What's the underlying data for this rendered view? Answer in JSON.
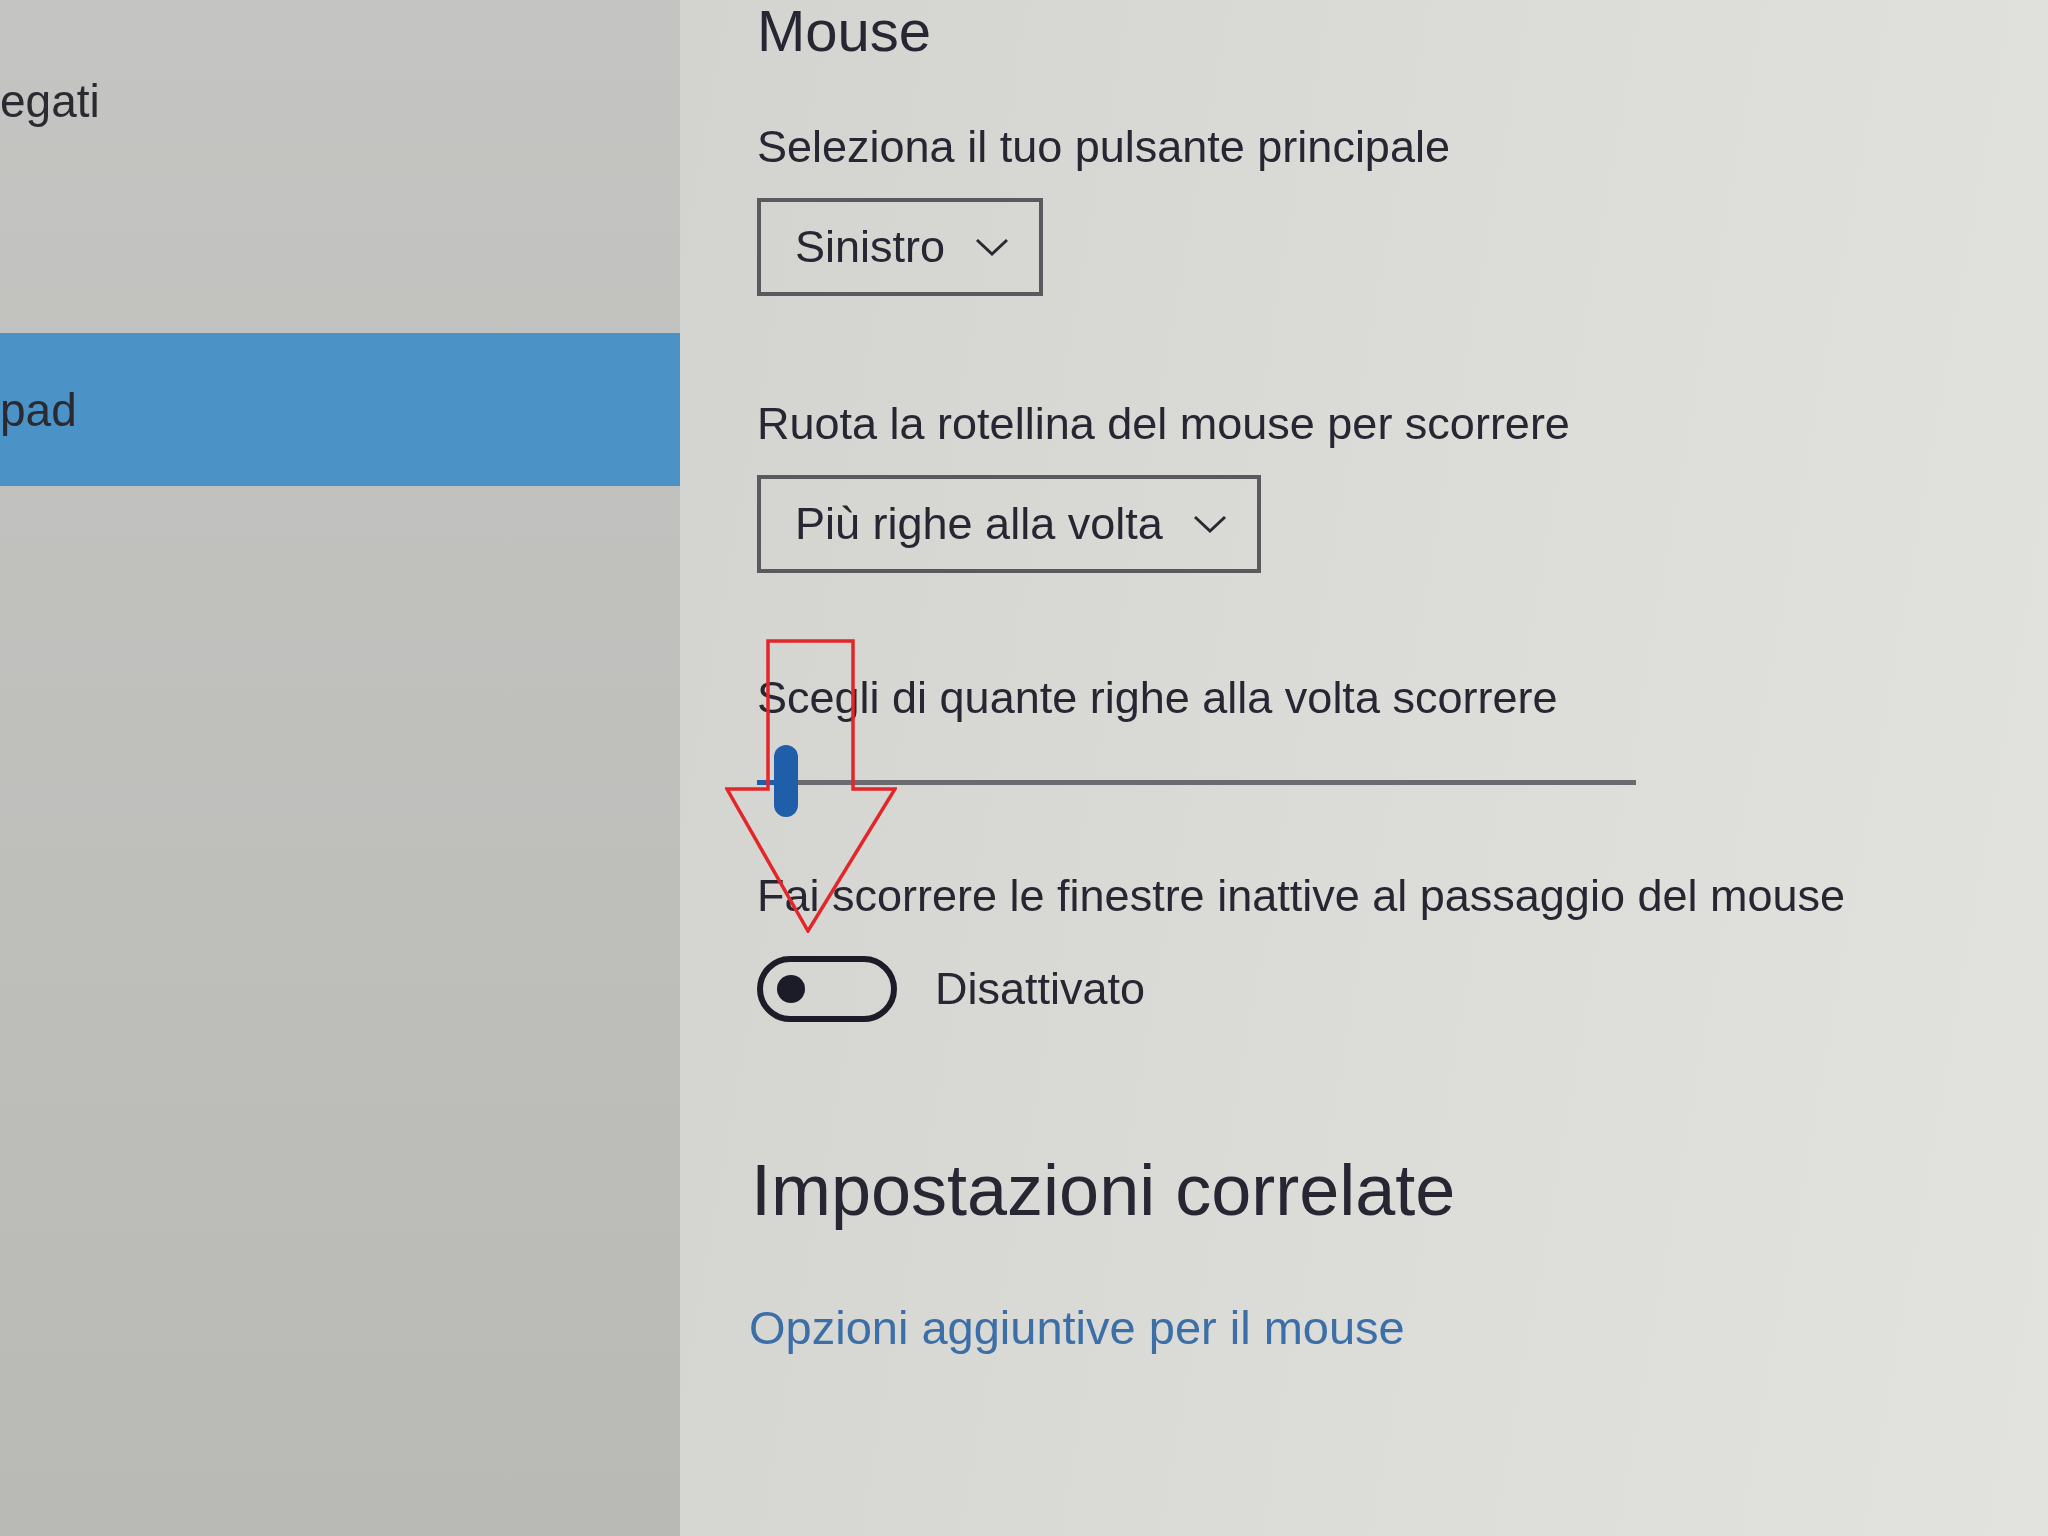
{
  "sidebar": {
    "items": [
      {
        "label": "egati",
        "selected": false
      },
      {
        "label": "pad",
        "selected": true
      }
    ]
  },
  "page": {
    "title": "Mouse"
  },
  "settings": [
    {
      "kind": "dropdown",
      "label": "Seleziona il tuo pulsante principale",
      "value": "Sinistro"
    },
    {
      "kind": "dropdown",
      "label": "Ruota la rotellina del mouse per scorrere",
      "value": "Più righe alla volta"
    },
    {
      "kind": "slider",
      "label": "Scegli di quante righe alla volta scorrere",
      "level": 0.02
    },
    {
      "kind": "toggle",
      "label": "Fai scorrere le finestre inattive al passaggio del mouse",
      "on": false,
      "state_text": "Disattivato"
    }
  ],
  "related": {
    "title": "Impostazioni correlate",
    "links": [
      "Opzioni aggiuntive per il mouse"
    ]
  }
}
